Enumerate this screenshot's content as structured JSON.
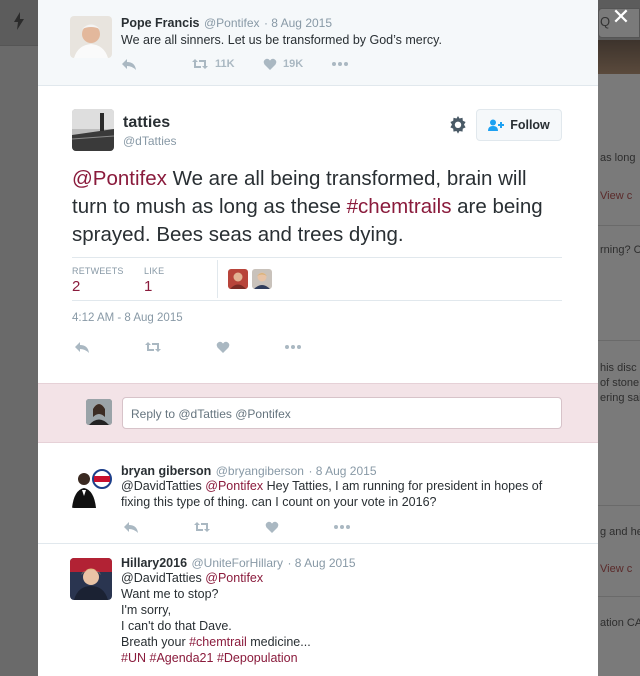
{
  "background": {
    "right_texts": [
      "as long",
      "View c",
      "rning? C",
      "his disc",
      "of stone",
      "ering sai",
      "g and he",
      "View c",
      "ation CA"
    ]
  },
  "close_label": "✕",
  "parent_tweet": {
    "name": "Pope Francis",
    "handle": "@Pontifex",
    "date": "· 8 Aug 2015",
    "text": "We are all sinners.  Let us be transformed by God’s mercy.",
    "retweets": "11K",
    "likes": "19K"
  },
  "main_tweet": {
    "name": "tatties",
    "handle": "@dTatties",
    "follow_label": "Follow",
    "text_parts": {
      "mention": "@Pontifex",
      "text1": " We are all being transformed,  brain will turn to mush as long as these ",
      "hashtag": "#chemtrails",
      "text2": " are being sprayed. Bees seas and trees dying."
    },
    "retweets_label": "RETWEETS",
    "retweets_value": "2",
    "likes_label": "LIKE",
    "likes_value": "1",
    "timestamp": "4:12 AM - 8 Aug 2015"
  },
  "reply_box": {
    "placeholder": "Reply to @dTatties @Pontifex"
  },
  "replies": [
    {
      "name": "bryan giberson",
      "handle": "@bryangiberson",
      "date": "· 8 Aug 2015",
      "mention1": "@DavidTatties",
      "mention2": "@Pontifex",
      "text": " Hey Tatties, I am running for president in hopes of fixing this type of thing. can I count on your vote in 2016?"
    },
    {
      "name": "Hillary2016",
      "handle": "@UniteForHillary",
      "date": "· 8 Aug 2015",
      "line1_mention1": "@DavidTatties",
      "line1_mention2": "@Pontifex",
      "line2": "Want me to stop?",
      "line3": "I'm sorry,",
      "line4": "I can't do that Dave.",
      "line5_text": "Breath your ",
      "line5_hashtag": "#chemtrail",
      "line5_text2": " medicine...",
      "line6_tag1": "#UN",
      "line6_tag2": "#Agenda21",
      "line6_tag3": "#Depopulation"
    }
  ]
}
